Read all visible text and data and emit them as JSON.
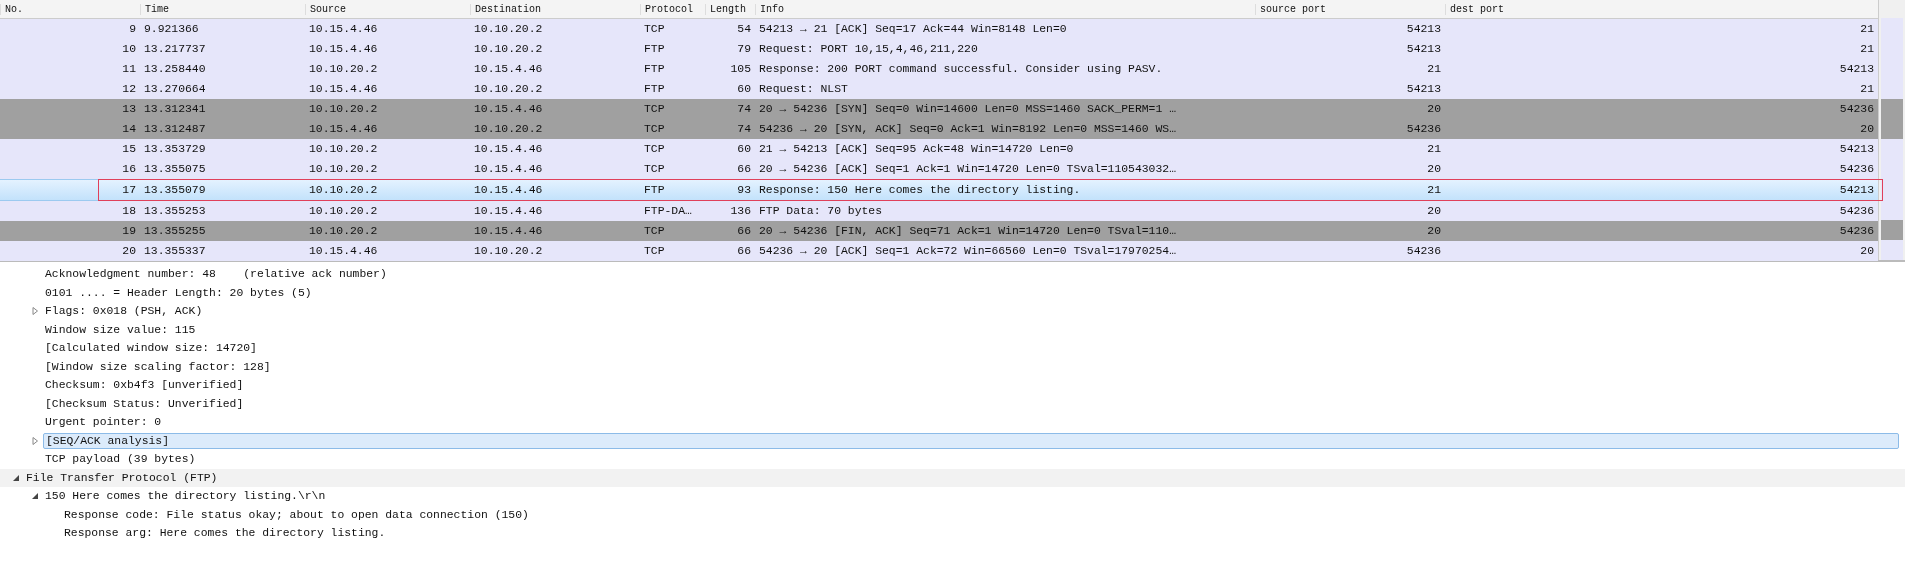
{
  "packet_list": {
    "columns": [
      "No.",
      "Time",
      "Source",
      "Destination",
      "Protocol",
      "Length",
      "Info",
      "source port",
      "dest port"
    ],
    "rows": [
      {
        "cells": [
          "9",
          "9.921366",
          "10.15.4.46",
          "10.10.20.2",
          "TCP",
          "54",
          "54213 → 21 [ACK] Seq=17 Ack=44 Win=8148 Len=0",
          "54213",
          "21"
        ],
        "color": "#e6e6fa",
        "selected": false,
        "marked": false
      },
      {
        "cells": [
          "10",
          "13.217737",
          "10.15.4.46",
          "10.10.20.2",
          "FTP",
          "79",
          "Request: PORT 10,15,4,46,211,220",
          "54213",
          "21"
        ],
        "color": "#e6e6fa",
        "selected": false,
        "marked": false
      },
      {
        "cells": [
          "11",
          "13.258440",
          "10.10.20.2",
          "10.15.4.46",
          "FTP",
          "105",
          "Response: 200 PORT command successful. Consider using PASV.",
          "21",
          "54213"
        ],
        "color": "#e6e6fa",
        "selected": false,
        "marked": false
      },
      {
        "cells": [
          "12",
          "13.270664",
          "10.15.4.46",
          "10.10.20.2",
          "FTP",
          "60",
          "Request: NLST",
          "54213",
          "21"
        ],
        "color": "#e6e6fa",
        "selected": false,
        "marked": false
      },
      {
        "cells": [
          "13",
          "13.312341",
          "10.10.20.2",
          "10.15.4.46",
          "TCP",
          "74",
          "20 → 54236 [SYN] Seq=0 Win=14600 Len=0 MSS=1460 SACK_PERM=1 …",
          "20",
          "54236"
        ],
        "color": "#a0a0a0",
        "selected": false,
        "marked": false
      },
      {
        "cells": [
          "14",
          "13.312487",
          "10.15.4.46",
          "10.10.20.2",
          "TCP",
          "74",
          "54236 → 20 [SYN, ACK] Seq=0 Ack=1 Win=8192 Len=0 MSS=1460 WS…",
          "54236",
          "20"
        ],
        "color": "#a0a0a0",
        "selected": false,
        "marked": false
      },
      {
        "cells": [
          "15",
          "13.353729",
          "10.10.20.2",
          "10.15.4.46",
          "TCP",
          "60",
          "21 → 54213 [ACK] Seq=95 Ack=48 Win=14720 Len=0",
          "21",
          "54213"
        ],
        "color": "#e6e6fa",
        "selected": false,
        "marked": false
      },
      {
        "cells": [
          "16",
          "13.355075",
          "10.10.20.2",
          "10.15.4.46",
          "TCP",
          "66",
          "20 → 54236 [ACK] Seq=1 Ack=1 Win=14720 Len=0 TSval=110543032…",
          "20",
          "54236"
        ],
        "color": "#e6e6fa",
        "selected": false,
        "marked": false
      },
      {
        "cells": [
          "17",
          "13.355079",
          "10.10.20.2",
          "10.15.4.46",
          "FTP",
          "93",
          "Response: 150 Here comes the directory listing.",
          "21",
          "54213"
        ],
        "color": "#e6e6fa",
        "selected": true,
        "marked": true
      },
      {
        "cells": [
          "18",
          "13.355253",
          "10.10.20.2",
          "10.15.4.46",
          "FTP-DA…",
          "136",
          "FTP Data: 70 bytes",
          "20",
          "54236"
        ],
        "color": "#e6e6fa",
        "selected": false,
        "marked": false
      },
      {
        "cells": [
          "19",
          "13.355255",
          "10.10.20.2",
          "10.15.4.46",
          "TCP",
          "66",
          "20 → 54236 [FIN, ACK] Seq=71 Ack=1 Win=14720 Len=0 TSval=110…",
          "20",
          "54236"
        ],
        "color": "#a0a0a0",
        "selected": false,
        "marked": false
      },
      {
        "cells": [
          "20",
          "13.355337",
          "10.15.4.46",
          "10.10.20.2",
          "TCP",
          "66",
          "54236 → 20 [ACK] Seq=1 Ack=72 Win=66560 Len=0 TSval=17970254…",
          "54236",
          "20"
        ],
        "color": "#e6e6fa",
        "selected": false,
        "marked": false
      }
    ]
  },
  "packet_details": {
    "tcp_fields": [
      {
        "label": "Acknowledgment number: 48    (relative ack number)",
        "selected": false
      },
      {
        "label": "0101 .... = Header Length: 20 bytes (5)",
        "selected": false
      },
      {
        "label": "Flags: 0x018 (PSH, ACK)",
        "expanded": false,
        "selected": false
      },
      {
        "label": "Window size value: 115",
        "selected": false
      },
      {
        "label": "[Calculated window size: 14720]",
        "selected": false
      },
      {
        "label": "[Window size scaling factor: 128]",
        "selected": false
      },
      {
        "label": "Checksum: 0xb4f3 [unverified]",
        "selected": false
      },
      {
        "label": "[Checksum Status: Unverified]",
        "selected": false
      },
      {
        "label": "Urgent pointer: 0",
        "selected": false
      },
      {
        "label": "[SEQ/ACK analysis]",
        "expanded": false,
        "selected": true
      },
      {
        "label": "TCP payload (39 bytes)",
        "selected": false
      }
    ],
    "sections": [
      {
        "label": "File Transfer Protocol (FTP)",
        "expanded": true,
        "selected": false,
        "children": [
          {
            "label": "150 Here comes the directory listing.\\r\\n",
            "expanded": true,
            "selected": false,
            "children": [
              {
                "label": "Response code: File status okay; about to open data connection (150)",
                "selected": false
              },
              {
                "label": "Response arg: Here comes the directory listing.",
                "selected": false
              }
            ]
          }
        ]
      }
    ]
  }
}
